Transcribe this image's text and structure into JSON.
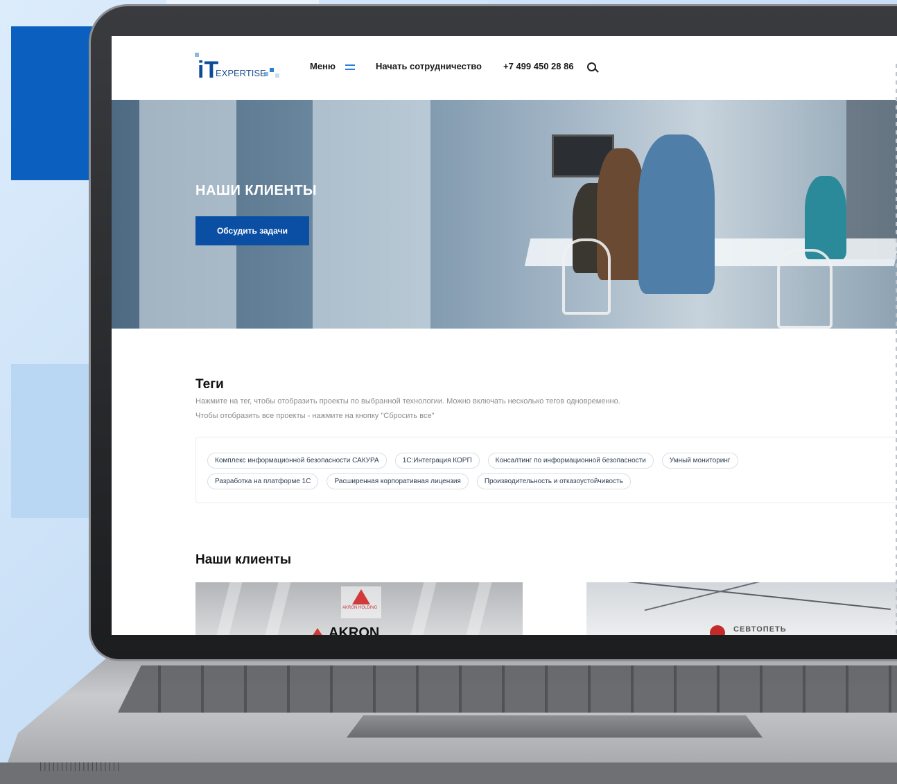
{
  "header": {
    "logo_it": "iT",
    "logo_text": "EXPERTISE",
    "menu_label": "Меню",
    "cta_link": "Начать сотрудничество",
    "phone": "+7 499 450 28 86"
  },
  "hero": {
    "title": "НАШИ КЛИЕНТЫ",
    "button_label": "Обсудить задачи"
  },
  "tags": {
    "title": "Теги",
    "description_line1": "Нажмите на тег, чтобы отобразить проекты по выбранной технологии. Можно включать несколько тегов одновременно.",
    "description_line2": "Чтобы отобразить все проекты - нажмите на кнопку \"Сбросить все\"",
    "items": [
      "Комплекс информационной безопасности САКУРА",
      "1С:Интеграция КОРП",
      "Консалтинг по информационной безопасности",
      "Умный мониторинг",
      "Разработка на платформе 1С",
      "Расширенная корпоративная лицензия",
      "Производительность и отказоустойчивость"
    ]
  },
  "clients": {
    "title": "Наши клиенты",
    "card1_name": "AKRON",
    "card1_caption": "AKRON HOLDING",
    "card2_name": "СЕВТОПЕТЬ"
  },
  "colors": {
    "brand_blue": "#0a4fa3",
    "accent_blue": "#0a5fbf"
  }
}
